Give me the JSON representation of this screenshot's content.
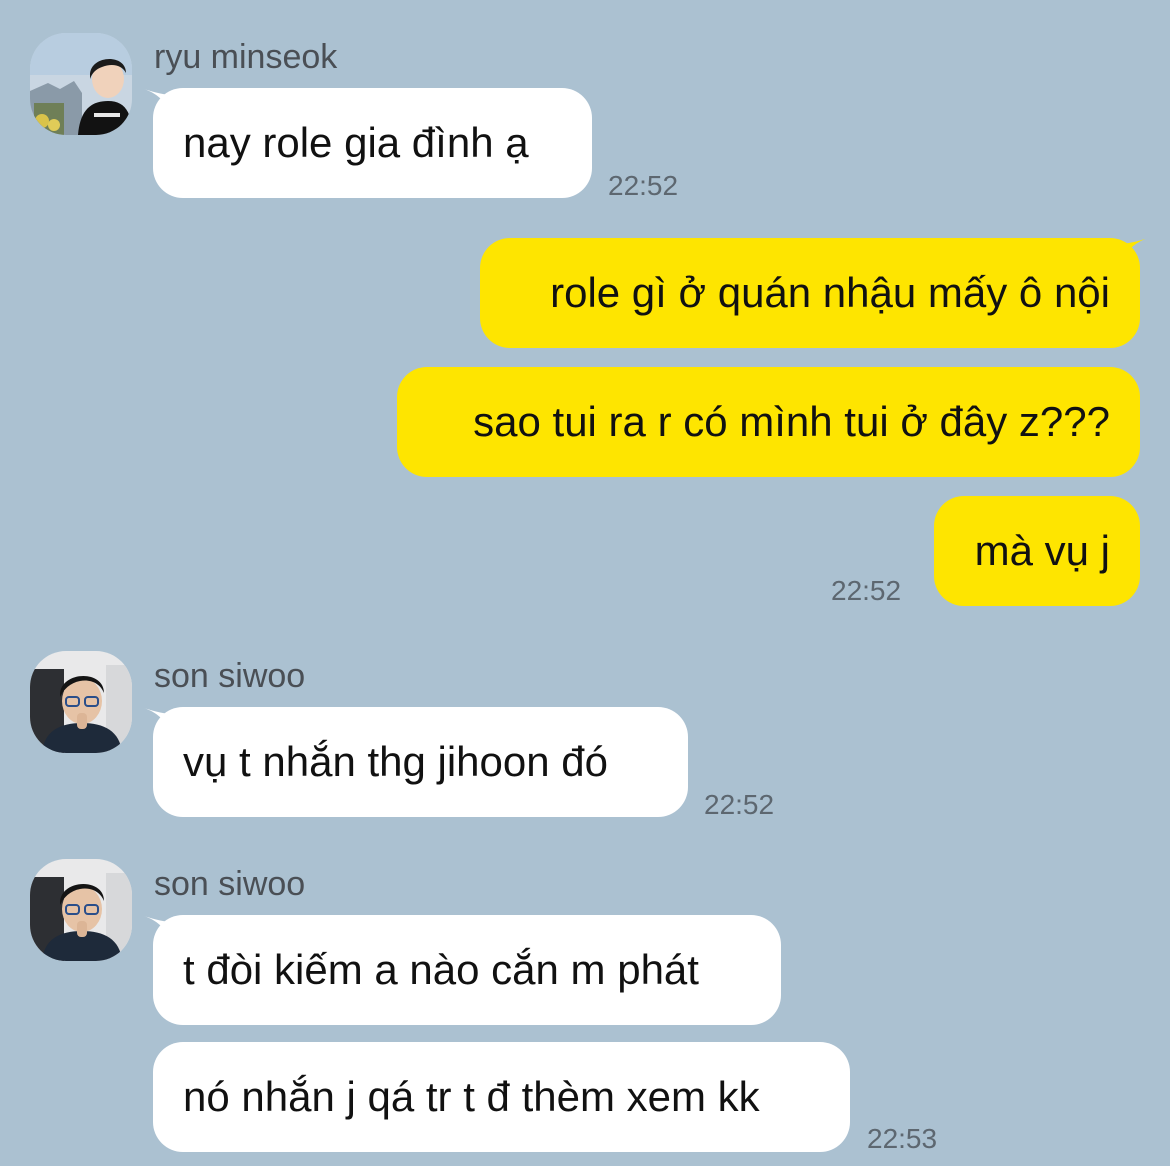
{
  "colors": {
    "background": "#abc1d1",
    "incoming_bubble": "#ffffff",
    "outgoing_bubble": "#fee500",
    "name_text": "#4a4f55",
    "time_text": "#5d6770"
  },
  "chat": {
    "group1": {
      "sender": "ryu minseok",
      "avatar": "ryu-minseok-profile-photo",
      "messages": [
        "nay role gia đình ạ"
      ],
      "time": "22:52"
    },
    "outgoing": {
      "messages": [
        "role gì ở quán nhậu mấy ô nội",
        "sao tui ra r có mình tui ở đây z???",
        "mà vụ j"
      ],
      "time": "22:52"
    },
    "group2": {
      "sender": "son siwoo",
      "avatar": "son-siwoo-profile-photo",
      "messages": [
        "vụ t nhắn thg jihoon đó"
      ],
      "time": "22:52"
    },
    "group3": {
      "sender": "son siwoo",
      "avatar": "son-siwoo-profile-photo",
      "messages": [
        "t đòi kiếm a nào cắn m phát",
        "nó nhắn j qá tr t đ thèm xem kk"
      ],
      "time": "22:53"
    }
  }
}
